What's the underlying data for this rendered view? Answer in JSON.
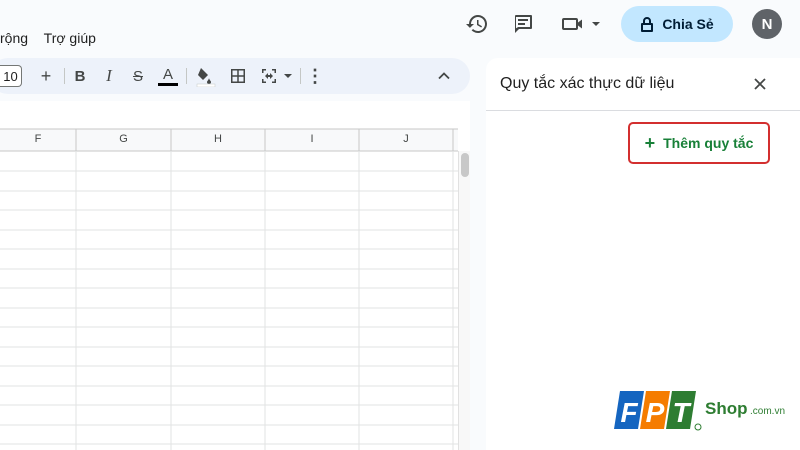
{
  "menu": {
    "items": [
      "rộng",
      "Trợ giúp"
    ]
  },
  "header": {
    "share_label": "Chia Sẻ",
    "avatar_initial": "N"
  },
  "toolbar": {
    "font_size": "10",
    "plus": "+",
    "bold": "B",
    "italic": "I",
    "strike": "S",
    "text_color": "A",
    "more": "⋮"
  },
  "sheet": {
    "columns": [
      "F",
      "G",
      "H",
      "I",
      "J"
    ]
  },
  "panel": {
    "title": "Quy tắc xác thực dữ liệu",
    "add_rule_label": "Thêm quy tắc",
    "add_rule_icon": "+"
  },
  "watermark": {
    "brand_letters": [
      "F",
      "P",
      "T"
    ],
    "shop_text": "Shop",
    "domain_suffix": ".com.vn"
  }
}
